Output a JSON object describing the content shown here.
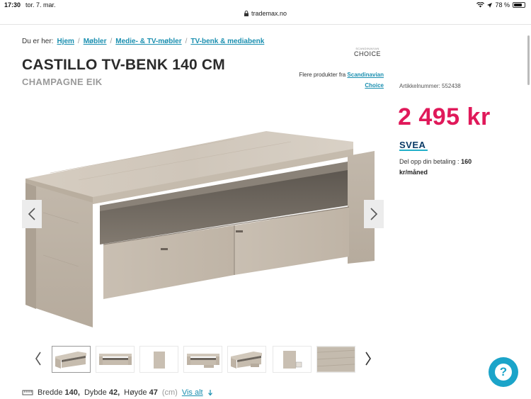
{
  "status": {
    "time": "17:30",
    "date": "tor. 7. mar.",
    "battery": "78 %",
    "battery_level": 0.78
  },
  "browser": {
    "url": "trademax.no"
  },
  "breadcrumb": {
    "prefix": "Du er her:",
    "items": [
      "Hjem",
      "Møbler",
      "Medie- & TV-møbler",
      "TV-benk & mediabenk"
    ],
    "separator": "/"
  },
  "brand_logo": {
    "small": "SCANDINAVIAN",
    "big": "CHOICE"
  },
  "product": {
    "title": "CASTILLO TV-BENK 140 CM",
    "subtitle": "CHAMPAGNE EIK",
    "more_prefix": "Flere produkter fra",
    "more_link": "Scandinavian Choice",
    "article_number": "Artikkelnummer: 552438",
    "price": "2 495 kr",
    "payment_brand": "SVEA",
    "installment_label": "Del opp din betaling :",
    "installment_value": "160 kr/måned"
  },
  "gallery": {
    "thumb_count": 7,
    "active_index": 0
  },
  "dimensions": {
    "width_label": "Bredde",
    "width_value": "140,",
    "depth_label": "Dybde",
    "depth_value": "42,",
    "height_label": "Høyde",
    "height_value": "47",
    "unit": "(cm)",
    "see_all": "Vis alt"
  },
  "help": {
    "symbol": "?"
  },
  "colors": {
    "accent": "#1a8fb0",
    "price": "#e0195a",
    "svea": "#0a3a66",
    "help": "#1ba4c9"
  }
}
